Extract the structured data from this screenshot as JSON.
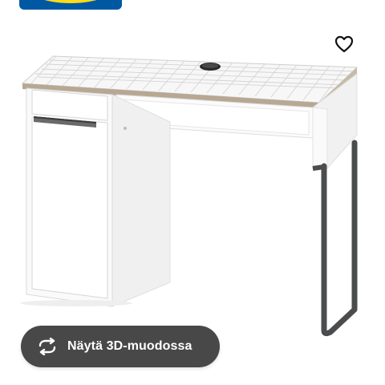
{
  "brand": {
    "logo_colors": {
      "blue": "#0058a3",
      "yellow": "#ffda1a"
    }
  },
  "product": {
    "image": "white-desk-with-drawer-cabinet-and-grid-top"
  },
  "actions": {
    "favourite_icon": "heart-outline-icon",
    "view3d": {
      "icon": "rotate-arrows-icon",
      "label": "Näytä 3D-muodossa"
    }
  }
}
